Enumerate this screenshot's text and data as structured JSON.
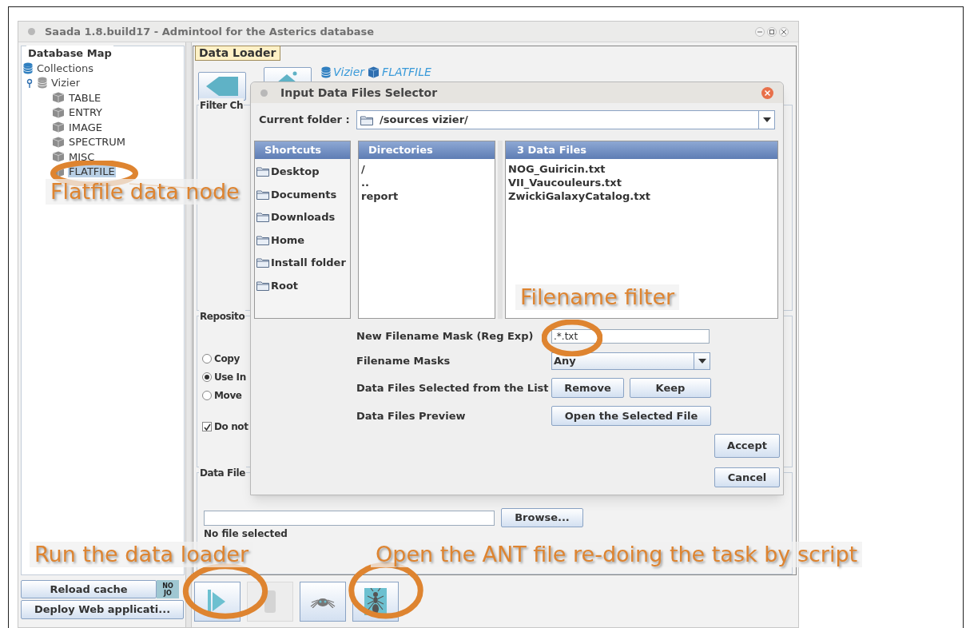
{
  "window": {
    "title": "Saada 1.8.build17 - Admintool for the Asterics database"
  },
  "database_map": {
    "title": "Database Map",
    "tree": [
      {
        "label": "Collections",
        "expanded": true,
        "children": [
          {
            "label": "Vizier",
            "expanded": true,
            "children": [
              {
                "label": "TABLE",
                "selected": false
              },
              {
                "label": "ENTRY",
                "selected": false
              },
              {
                "label": "IMAGE",
                "selected": false
              },
              {
                "label": "SPECTRUM",
                "selected": false
              },
              {
                "label": "MISC",
                "selected": false
              },
              {
                "label": "FLATFILE",
                "selected": true
              }
            ]
          }
        ]
      }
    ]
  },
  "sidebar_buttons": {
    "reload": "Reload cache",
    "badge": [
      "NO",
      "JO"
    ],
    "deploy": "Deploy Web applicati..."
  },
  "data_loader": {
    "tab": "Data Loader",
    "breadcrumb": [
      "Vizier",
      "FLATFILE"
    ],
    "filter_section": {
      "title": "Filter Ch"
    },
    "repository_section": {
      "title": "Reposito",
      "options": [
        {
          "label": "Copy",
          "selected": false
        },
        {
          "label": "Use In",
          "selected": true
        },
        {
          "label": "Move",
          "selected": false
        }
      ],
      "checkbox": {
        "label": "Do not",
        "checked": true
      }
    },
    "data_file_section": {
      "title": "Data File",
      "browse": "Browse...",
      "status": "No file selected"
    },
    "toolbar": [
      {
        "kind": "run",
        "disabled": false
      },
      {
        "kind": "stop",
        "disabled": true
      },
      {
        "kind": "spider",
        "disabled": false
      },
      {
        "kind": "ant",
        "disabled": false
      }
    ]
  },
  "dialog": {
    "title": "Input Data Files Selector",
    "current_folder_label": "Current folder :",
    "current_folder": "/sources vizier/",
    "shortcuts": {
      "header": "Shortcuts",
      "items": [
        "Desktop",
        "Documents",
        "Downloads",
        "Home",
        "Install folder",
        "Root"
      ]
    },
    "directories": {
      "header": "Directories",
      "items": [
        "/",
        "..",
        "report"
      ]
    },
    "files": {
      "header": "3 Data Files",
      "items": [
        "NOG_Guiricin.txt",
        "VII_Vaucouleurs.txt",
        "ZwickiGalaxyCatalog.txt"
      ]
    },
    "mask_label": "New Filename Mask (Reg Exp)",
    "mask_value": ".*.txt",
    "masks_label": "Filename Masks",
    "masks_value": "Any",
    "selected_label": "Data Files Selected from the List",
    "remove": "Remove",
    "keep": "Keep",
    "preview_label": "Data Files Preview",
    "open": "Open the Selected File",
    "accept": "Accept",
    "cancel": "Cancel"
  },
  "annotations": [
    {
      "kind": "flatfile",
      "text": "Flatfile data node"
    },
    {
      "kind": "filter",
      "text": "Filename filter"
    },
    {
      "kind": "run",
      "text": "Run the data loader"
    },
    {
      "kind": "ant",
      "text": "Open the ANT file re-doing the task by script"
    }
  ]
}
